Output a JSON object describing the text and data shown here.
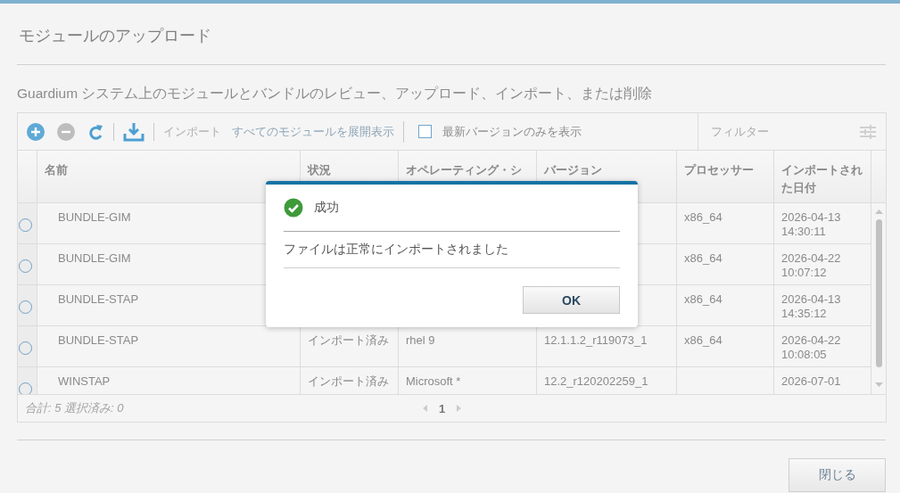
{
  "title": "モジュールのアップロード",
  "subtitle": "Guardium システム上のモジュールとバンドルのレビュー、アップロード、インポート、または削除",
  "toolbar": {
    "import": {
      "label": "インポート",
      "disabled": true
    },
    "expand_label": "すべてのモジュールを展開表示",
    "latest_only": {
      "label": "最新バージョンのみを表示",
      "checked": false
    },
    "filter": {
      "placeholder": "フィルター"
    }
  },
  "table": {
    "columns": [
      "名前",
      "状況",
      "オペレーティング・シ",
      "バージョン",
      "プロセッサー",
      "インポートされた日付"
    ],
    "rows": [
      {
        "selected": false,
        "name": "BUNDLE-GIM",
        "processor": "x86_64",
        "imported": "2026-04-13 14:30:11"
      },
      {
        "selected": false,
        "name": "BUNDLE-GIM",
        "processor": "x86_64",
        "imported": "2026-04-22 10:07:12"
      },
      {
        "selected": false,
        "name": "BUNDLE-STAP",
        "processor": "x86_64",
        "imported": "2026-04-13 14:35:12"
      },
      {
        "selected": false,
        "name": "BUNDLE-STAP",
        "status": "インポート済み",
        "os": "rhel 9",
        "version": "12.1.1.2_r119073_1",
        "processor": "x86_64",
        "imported": "2026-04-22 10:08:05"
      },
      {
        "selected": false,
        "name": "WINSTAP",
        "status": "インポート済み",
        "os": "Microsoft *",
        "version": "12.2_r120202259_1",
        "imported": "2026-07-01"
      }
    ]
  },
  "footer": {
    "summary": "合計: 5 選択済み: 0",
    "page": "1"
  },
  "dialog": {
    "title": "成功",
    "message": "ファイルは正常にインポートされました",
    "ok": "OK"
  },
  "close_button": "閉じる"
}
